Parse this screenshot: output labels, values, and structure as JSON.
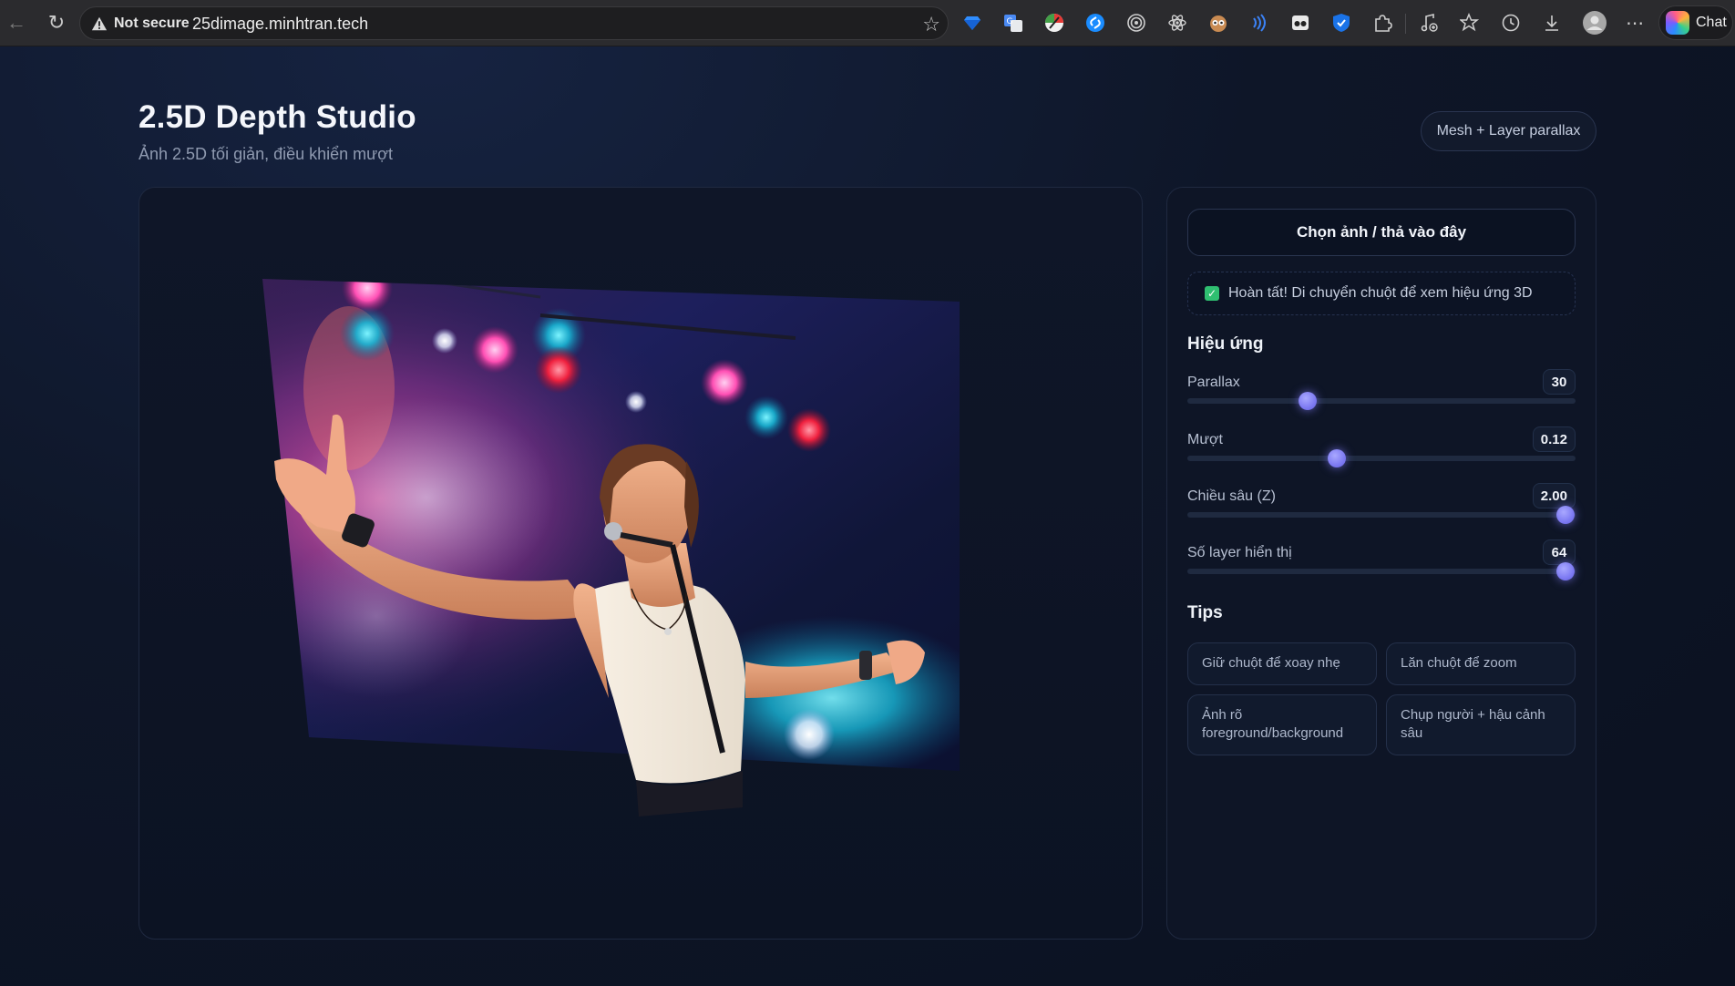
{
  "browser": {
    "security_label": "Not secure",
    "url": "25dimage.minhtran.tech",
    "chat_label": "Chat",
    "extensions": [
      "gem-icon",
      "translate-icon",
      "colorwheel-icon",
      "shazam-icon",
      "target-icon",
      "atom-icon",
      "owl-icon",
      "wave-icon",
      "mask-icon",
      "shield-icon",
      "puzzle-icon",
      "music-add-icon",
      "favorites-icon",
      "history-icon",
      "download-icon",
      "profile-icon",
      "more-icon"
    ]
  },
  "header": {
    "title": "2.5D Depth Studio",
    "subtitle": "Ảnh 2.5D tối giản, điều khiển mượt",
    "mode_badge": "Mesh + Layer parallax"
  },
  "panel": {
    "upload_label": "Chọn ảnh / thả vào đây",
    "status_text": "Hoàn tất! Di chuyển chuột để xem hiệu ứng 3D",
    "effects_heading": "Hiệu ứng",
    "sliders": [
      {
        "label": "Parallax",
        "value": "30",
        "fraction": 0.31
      },
      {
        "label": "Mượt",
        "value": "0.12",
        "fraction": 0.385
      },
      {
        "label": "Chiều sâu (Z)",
        "value": "2.00",
        "fraction": 0.975
      },
      {
        "label": "Số layer hiển thị",
        "value": "64",
        "fraction": 0.975
      }
    ],
    "tips_heading": "Tips",
    "tips": [
      "Giữ chuột để xoay nhẹ",
      "Lăn chuột để zoom",
      "Ảnh rõ foreground/background",
      "Chụp người + hậu cảnh sâu"
    ]
  },
  "colors": {
    "accent": "#7d7af2",
    "success": "#2fbf71",
    "background": "#0c1220"
  }
}
